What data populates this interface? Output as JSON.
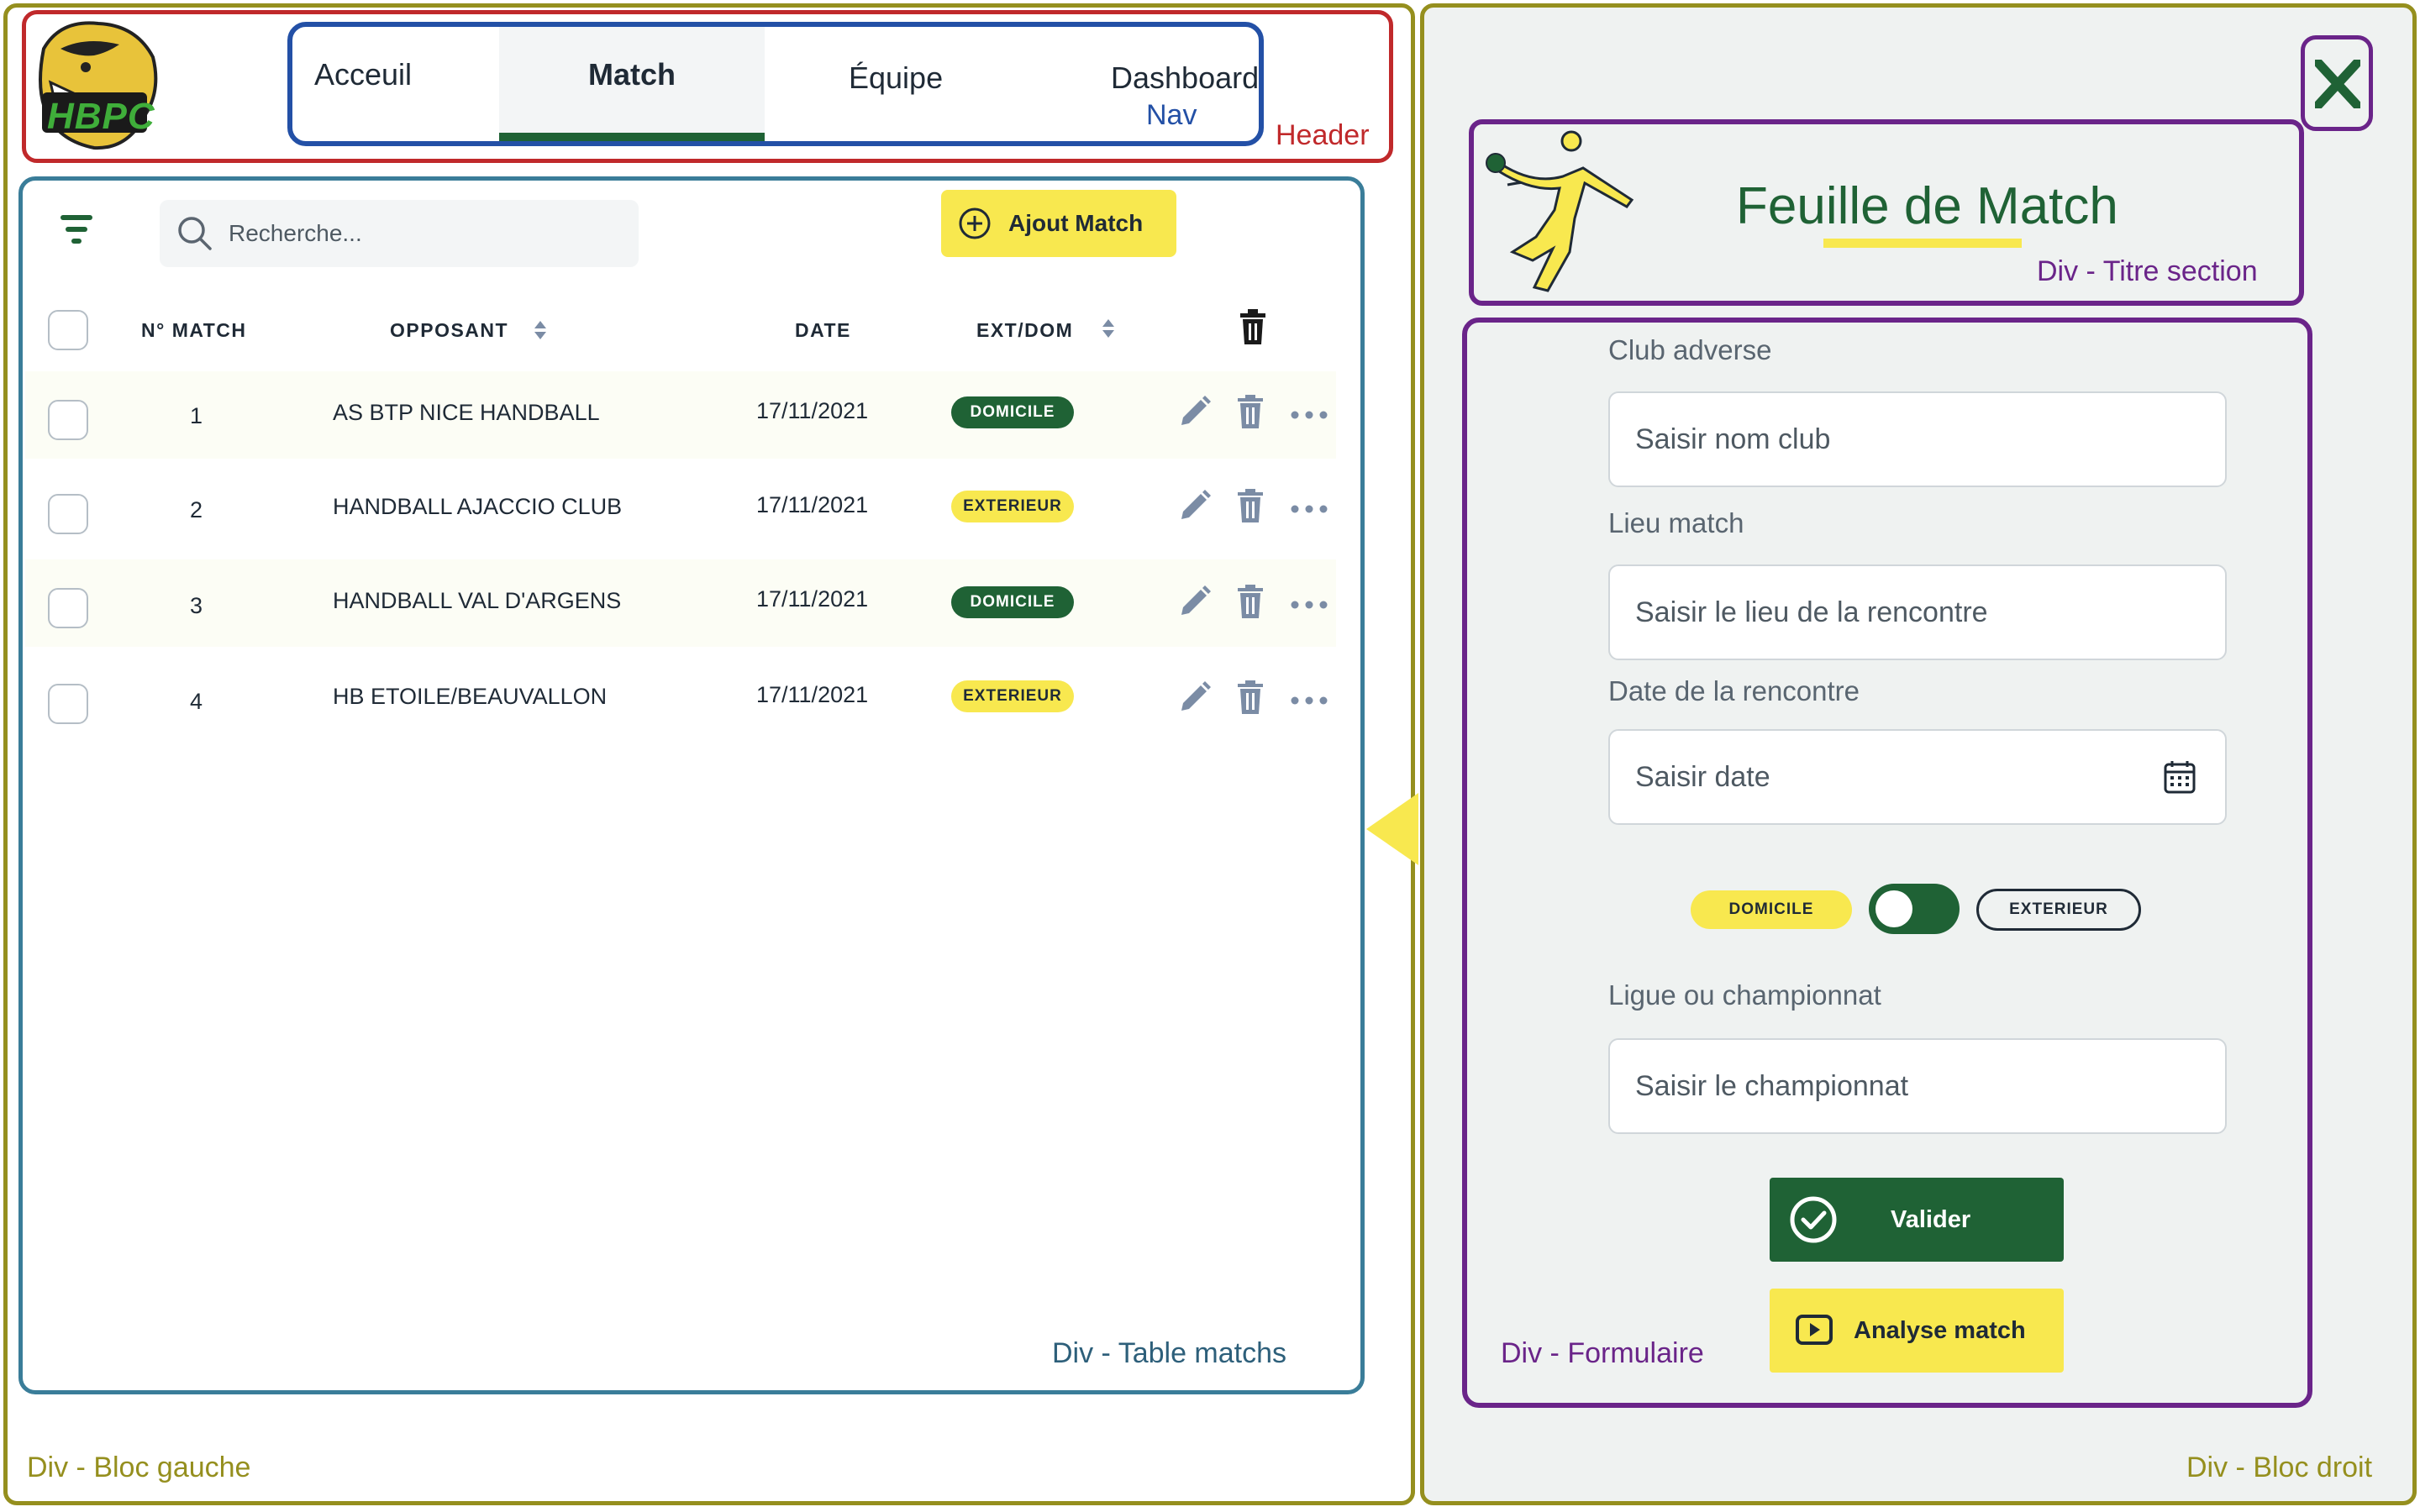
{
  "colors": {
    "primary_green": "#1f6235",
    "accent_yellow": "#f8e84f",
    "header_red": "#c0292b",
    "nav_blue": "#2350a6",
    "table_blue": "#3a7d99",
    "block_olive": "#958f1e",
    "purple": "#6a2489"
  },
  "logo": {
    "text": "HBPC"
  },
  "nav": {
    "tabs": [
      {
        "label": "Acceuil"
      },
      {
        "label": "Match",
        "active": true
      },
      {
        "label": "Équipe"
      },
      {
        "label": "Dashboards"
      }
    ],
    "annotation": "Nav"
  },
  "header": {
    "annotation": "Header"
  },
  "table": {
    "search_placeholder": "Recherche...",
    "add_button": "Ajout Match",
    "headers": {
      "num": "N° MATCH",
      "opponent": "OPPOSANT",
      "date": "DATE",
      "extdom": "EXT/DOM"
    },
    "rows": [
      {
        "num": "1",
        "opponent": "AS BTP NICE HANDBALL",
        "date": "17/11/2021",
        "status": "DOMICILE"
      },
      {
        "num": "2",
        "opponent": "HANDBALL AJACCIO CLUB",
        "date": "17/11/2021",
        "status": "EXTERIEUR"
      },
      {
        "num": "3",
        "opponent": "HANDBALL VAL D'ARGENS",
        "date": "17/11/2021",
        "status": "DOMICILE"
      },
      {
        "num": "4",
        "opponent": "HB ETOILE/BEAUVALLON",
        "date": "17/11/2021",
        "status": "EXTERIEUR"
      }
    ],
    "annotation": "Div - Table matchs"
  },
  "left_block_annotation": "Div - Bloc gauche",
  "right_block_annotation": "Div - Bloc droit",
  "title_section": {
    "title": "Feuille de Match",
    "annotation": "Div - Titre section"
  },
  "form": {
    "club_label": "Club adverse",
    "club_placeholder": "Saisir nom club",
    "lieu_label": "Lieu match",
    "lieu_placeholder": "Saisir le lieu de la rencontre",
    "date_label": "Date de la rencontre",
    "date_placeholder": "Saisir date",
    "toggle_left": "DOMICILE",
    "toggle_right": "EXTERIEUR",
    "ligue_label": "Ligue ou championnat",
    "ligue_placeholder": "Saisir le championnat",
    "validate_button": "Valider",
    "analyse_button": "Analyse match",
    "annotation": "Div - Formulaire"
  }
}
